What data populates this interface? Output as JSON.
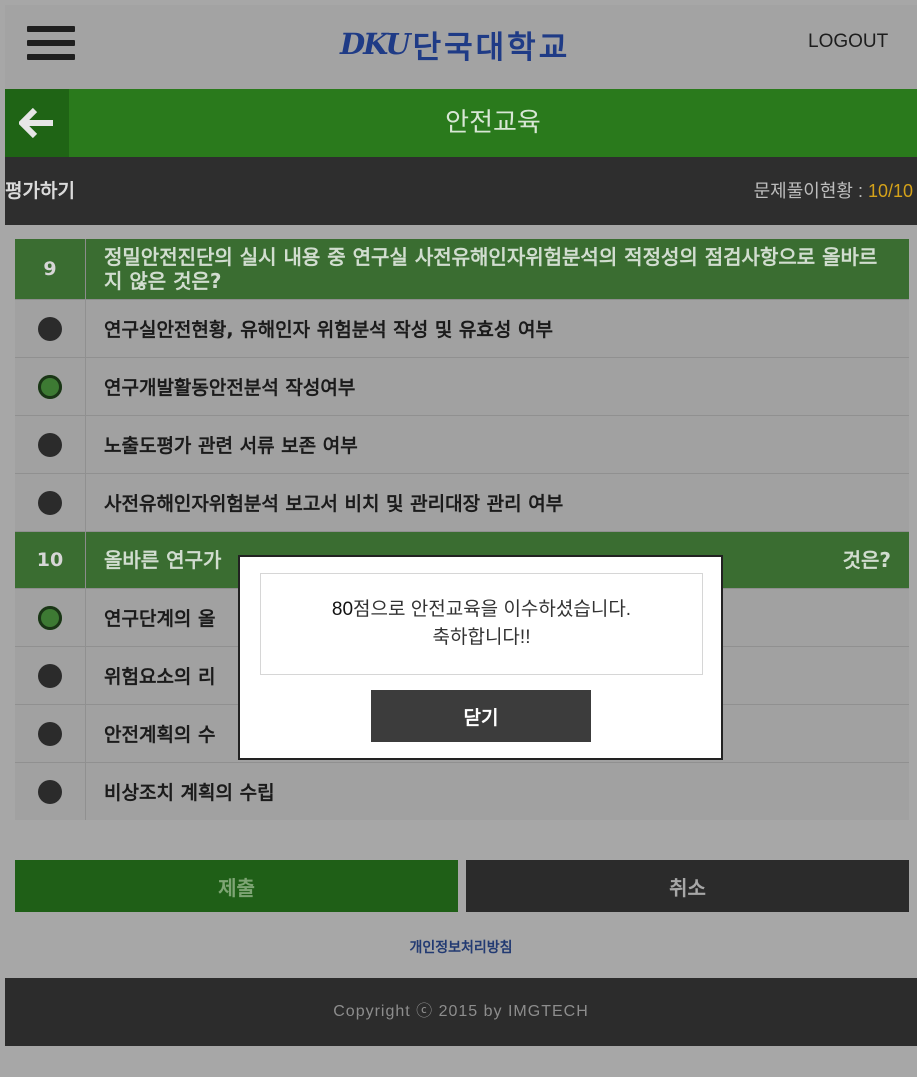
{
  "header": {
    "logo_mark": "DKU",
    "logo_name": "단국대학교",
    "logout_label": "LOGOUT"
  },
  "title_bar": {
    "title": "안전교육"
  },
  "status": {
    "section_label": "평가하기",
    "progress_label": "문제풀이현황 : ",
    "progress_value": "10/10"
  },
  "questions": [
    {
      "number": "9",
      "text": "정밀안전진단의 실시 내용 중 연구실 사전유해인자위험분석의 적정성의 점검사항으로 올바르지 않은 것은?",
      "options": [
        {
          "text": "연구실안전현황, 유해인자 위험분석 작성 및 유효성 여부",
          "selected": false
        },
        {
          "text": "연구개발활동안전분석 작성여부",
          "selected": true
        },
        {
          "text": "노출도평가 관련 서류 보존 여부",
          "selected": false
        },
        {
          "text": "사전유해인자위험분석 보고서 비치 및 관리대장 관리 여부",
          "selected": false
        }
      ]
    },
    {
      "number": "10",
      "text_start": "올바른 연구가",
      "text_end": "것은?",
      "options": [
        {
          "text": "연구단계의 올",
          "selected": true
        },
        {
          "text": "위험요소의 리",
          "selected": false
        },
        {
          "text": "안전계획의 수",
          "selected": false
        },
        {
          "text": "비상조치 계획의 수립",
          "selected": false
        }
      ]
    }
  ],
  "actions": {
    "submit_label": "제출",
    "cancel_label": "취소"
  },
  "footer": {
    "privacy_link": "개인정보처리방침",
    "copyright": "Copyright ⓒ 2015 by IMGTECH"
  },
  "modal": {
    "score": "80",
    "message_line1_rest": "점으로 안전교육을 이수하셨습니다.",
    "message_line2": "축하합니다!!",
    "close_label": "닫기"
  },
  "colors": {
    "header_bg": "#a3a3a3",
    "title_green": "#2a7a1c",
    "question_green": "#3a6d31",
    "dark_bar": "#2e2e2e",
    "progress_accent": "#d4a21a",
    "logo_blue": "#1f3b86"
  }
}
